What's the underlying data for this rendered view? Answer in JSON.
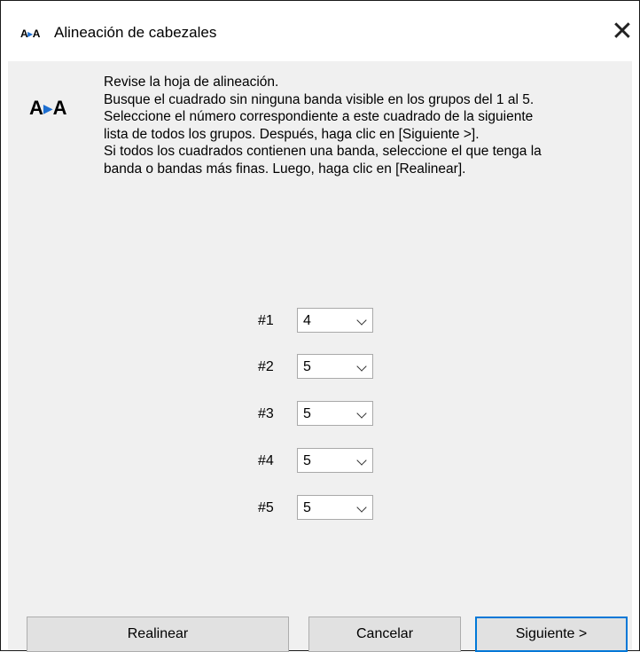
{
  "window": {
    "title_icon": "A▸A",
    "title": "Alineación de cabezales",
    "close_glyph": "✕"
  },
  "instructions": {
    "icon": "alignment-icon",
    "lines": [
      "Revise la hoja de alineación.",
      "Busque el cuadrado sin ninguna banda visible en los grupos del 1 al 5.",
      "Seleccione el número correspondiente a este cuadrado de la siguiente",
      "lista de todos los grupos. Después, haga clic en [Siguiente >].",
      "Si todos los cuadrados contienen una banda, seleccione el que tenga la",
      "banda o bandas más finas. Luego, haga clic en [Realinear]."
    ]
  },
  "selectors": [
    {
      "label": "#1",
      "value": "4"
    },
    {
      "label": "#2",
      "value": "5"
    },
    {
      "label": "#3",
      "value": "5"
    },
    {
      "label": "#4",
      "value": "5"
    },
    {
      "label": "#5",
      "value": "5"
    }
  ],
  "buttons": {
    "realign": "Realinear",
    "cancel": "Cancelar",
    "next": "Siguiente >"
  },
  "colors": {
    "accent": "#0078d7",
    "button_bg": "#e1e1e1",
    "panel_bg": "#f0f0f0"
  }
}
